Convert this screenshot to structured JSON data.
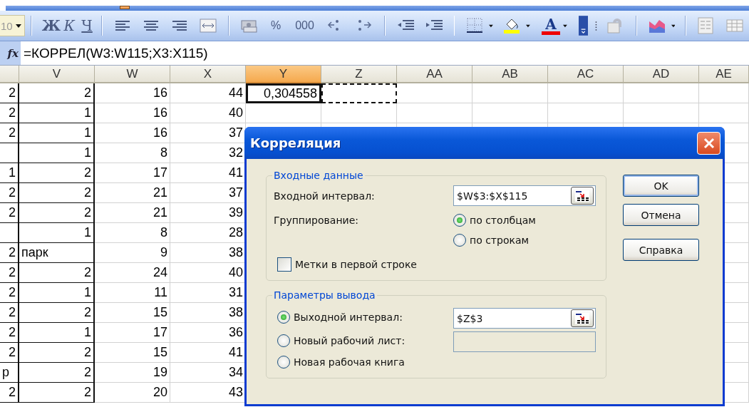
{
  "toolbar": {
    "font_size": "10",
    "style_buttons": [
      {
        "kind": "bold",
        "label": "Ж"
      },
      {
        "kind": "italic",
        "label": "К"
      },
      {
        "kind": "underline",
        "label": "Ч"
      }
    ],
    "number_buttons": [
      "%",
      "000"
    ],
    "font_color_button": "A"
  },
  "formula_bar": {
    "function_button": "fx",
    "formula": "=КОРРЕЛ(W3:W115;X3:X115)"
  },
  "sheet": {
    "columns": [
      {
        "selected": false
      },
      {
        "label": "V",
        "selected": false
      },
      {
        "label": "W",
        "selected": false
      },
      {
        "label": "X",
        "selected": false
      },
      {
        "label": "Y",
        "selected": true
      },
      {
        "label": "Z",
        "selected": false
      },
      {
        "label": "AA",
        "selected": false
      },
      {
        "label": "AB",
        "selected": false
      },
      {
        "label": "AC",
        "selected": false
      },
      {
        "label": "AD",
        "selected": false
      },
      {
        "label": "AE",
        "selected": false
      }
    ],
    "rows": [
      {
        "cells": [
          {
            "text": "2",
            "kind": "number"
          },
          {
            "text": "2",
            "kind": "number"
          },
          {
            "text": "16",
            "kind": "number"
          },
          {
            "text": "44",
            "kind": "number"
          },
          {
            "text": "0,304558",
            "kind": "number"
          }
        ],
        "y_selected": true,
        "z_marquee": true
      },
      {
        "cells": [
          {
            "text": "2",
            "kind": "number"
          },
          {
            "text": "1",
            "kind": "number"
          },
          {
            "text": "16",
            "kind": "number"
          },
          {
            "text": "40",
            "kind": "number"
          }
        ]
      },
      {
        "cells": [
          {
            "text": "2",
            "kind": "number"
          },
          {
            "text": "1",
            "kind": "number"
          },
          {
            "text": "16",
            "kind": "number"
          },
          {
            "text": "37",
            "kind": "number"
          }
        ]
      },
      {
        "cells": [
          null,
          {
            "text": "1",
            "kind": "number"
          },
          {
            "text": "8",
            "kind": "number"
          },
          {
            "text": "32",
            "kind": "number"
          }
        ]
      },
      {
        "cells": [
          {
            "text": "1",
            "kind": "number"
          },
          {
            "text": "2",
            "kind": "number"
          },
          {
            "text": "17",
            "kind": "number"
          },
          {
            "text": "41",
            "kind": "number"
          }
        ]
      },
      {
        "cells": [
          {
            "text": "2",
            "kind": "number"
          },
          {
            "text": "2",
            "kind": "number"
          },
          {
            "text": "21",
            "kind": "number"
          },
          {
            "text": "37",
            "kind": "number"
          }
        ]
      },
      {
        "cells": [
          {
            "text": "2",
            "kind": "number"
          },
          {
            "text": "2",
            "kind": "number"
          },
          {
            "text": "21",
            "kind": "number"
          },
          {
            "text": "39",
            "kind": "number"
          }
        ]
      },
      {
        "cells": [
          null,
          {
            "text": "1",
            "kind": "number"
          },
          {
            "text": "8",
            "kind": "number"
          },
          {
            "text": "28",
            "kind": "number"
          }
        ]
      },
      {
        "cells": [
          {
            "text": "2",
            "kind": "number"
          },
          {
            "text": "парк",
            "kind": "text"
          },
          {
            "text": "9",
            "kind": "number"
          },
          {
            "text": "38",
            "kind": "number"
          }
        ]
      },
      {
        "cells": [
          {
            "text": "2",
            "kind": "number"
          },
          {
            "text": "2",
            "kind": "number"
          },
          {
            "text": "24",
            "kind": "number"
          },
          {
            "text": "40",
            "kind": "number"
          }
        ]
      },
      {
        "cells": [
          {
            "text": "2",
            "kind": "number"
          },
          {
            "text": "1",
            "kind": "number"
          },
          {
            "text": "11",
            "kind": "number"
          },
          {
            "text": "31",
            "kind": "number"
          }
        ]
      },
      {
        "cells": [
          {
            "text": "2",
            "kind": "number"
          },
          {
            "text": "2",
            "kind": "number"
          },
          {
            "text": "15",
            "kind": "number"
          },
          {
            "text": "38",
            "kind": "number"
          }
        ]
      },
      {
        "cells": [
          {
            "text": "2",
            "kind": "number"
          },
          {
            "text": "1",
            "kind": "number"
          },
          {
            "text": "17",
            "kind": "number"
          },
          {
            "text": "36",
            "kind": "number"
          }
        ]
      },
      {
        "cells": [
          {
            "text": "2",
            "kind": "number"
          },
          {
            "text": "2",
            "kind": "number"
          },
          {
            "text": "15",
            "kind": "number"
          },
          {
            "text": "41",
            "kind": "number"
          }
        ]
      },
      {
        "cells": [
          {
            "text": "р",
            "kind": "text"
          },
          {
            "text": "2",
            "kind": "number"
          },
          {
            "text": "19",
            "kind": "number"
          },
          {
            "text": "34",
            "kind": "number"
          }
        ]
      },
      {
        "cells": [
          {
            "text": "2",
            "kind": "number"
          },
          {
            "text": "2",
            "kind": "number"
          },
          {
            "text": "20",
            "kind": "number"
          },
          {
            "text": "43",
            "kind": "number"
          }
        ]
      }
    ]
  },
  "dialog": {
    "title": "Корреляция",
    "input_group": {
      "legend": "Входные данные",
      "range_label": "Входной интервал:",
      "range_value": "$W$3:$X$115",
      "grouping_label": "Группирование:",
      "grouping_options": [
        {
          "label": "по столбцам",
          "selected": true
        },
        {
          "label": "по строкам",
          "selected": false
        }
      ],
      "labels_checkbox": {
        "label": "Метки в первой строке",
        "checked": false
      }
    },
    "output_group": {
      "legend": "Параметры вывода",
      "options": [
        {
          "label": "Выходной интервал:",
          "selected": true,
          "field": {
            "value": "$Z$3",
            "disabled": false
          }
        },
        {
          "label": "Новый рабочий лист:",
          "selected": false,
          "field": {
            "disabled": true
          }
        },
        {
          "label": "Новая рабочая книга",
          "selected": false
        }
      ]
    },
    "buttons": [
      {
        "label": "OK",
        "default": true
      },
      {
        "label": "Отмена",
        "default": false
      },
      {
        "label": "Справка",
        "default": false
      }
    ]
  }
}
